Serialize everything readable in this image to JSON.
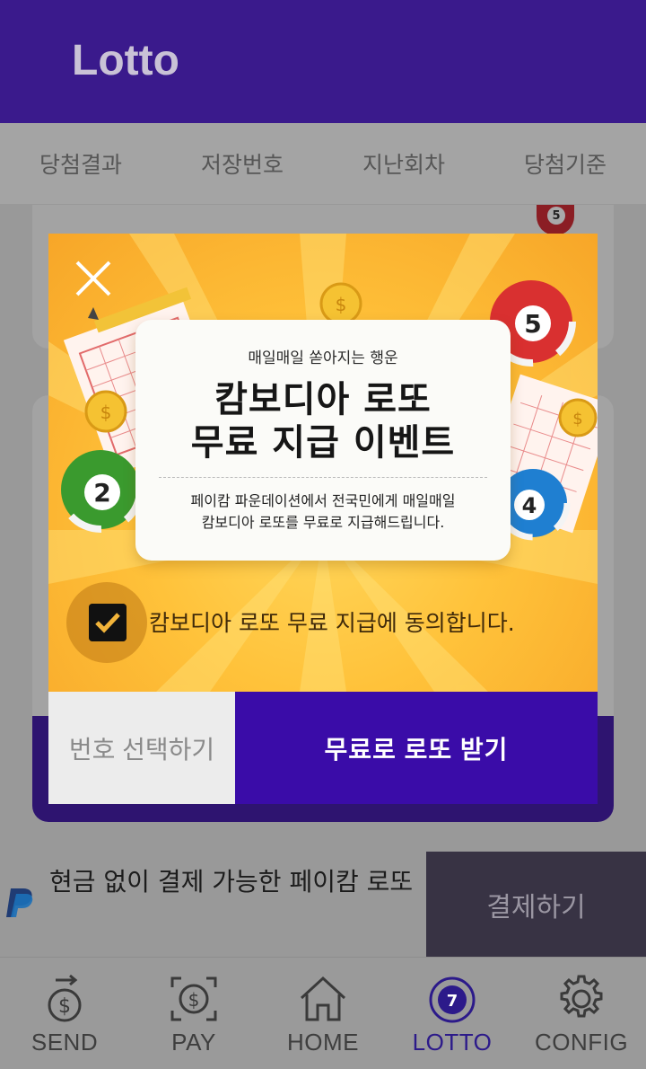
{
  "app": {
    "title": "Lotto"
  },
  "tabs": [
    {
      "label": "당첨결과"
    },
    {
      "label": "저장번호"
    },
    {
      "label": "지난회차"
    },
    {
      "label": "당첨기준"
    }
  ],
  "background": {
    "ball_number": "5"
  },
  "pay_banner": {
    "text": "현금 없이 결제 가능한 페이캄 로또",
    "button_label": "결제하기"
  },
  "bottom_nav": [
    {
      "label": "SEND",
      "icon": "send-money-icon",
      "active": false
    },
    {
      "label": "PAY",
      "icon": "scan-pay-icon",
      "active": false
    },
    {
      "label": "HOME",
      "icon": "home-icon",
      "active": false
    },
    {
      "label": "LOTTO",
      "icon": "lotto-ball-icon",
      "badge": "7",
      "active": true
    },
    {
      "label": "CONFIG",
      "icon": "gear-icon",
      "active": false
    }
  ],
  "modal": {
    "tagline": "매일매일 쏟아지는 행운",
    "title_line1": "캄보디아 로또",
    "title_line2": "무료 지급 이벤트",
    "description_line1": "페이캄 파운데이션에서 전국민에게 매일매일",
    "description_line2": "캄보디아 로또를 무료로 지급해드립니다.",
    "balls": [
      "5",
      "2",
      "4"
    ],
    "agree_label": "캄보디아 로또 무료 지급에 동의합니다.",
    "agree_checked": true,
    "select_button": "번호 선택하기",
    "receive_button": "무료로 로또 받기"
  },
  "colors": {
    "header": "#3a1a8c",
    "accent": "#3a0ca8",
    "active_nav": "#2c1a8a"
  }
}
